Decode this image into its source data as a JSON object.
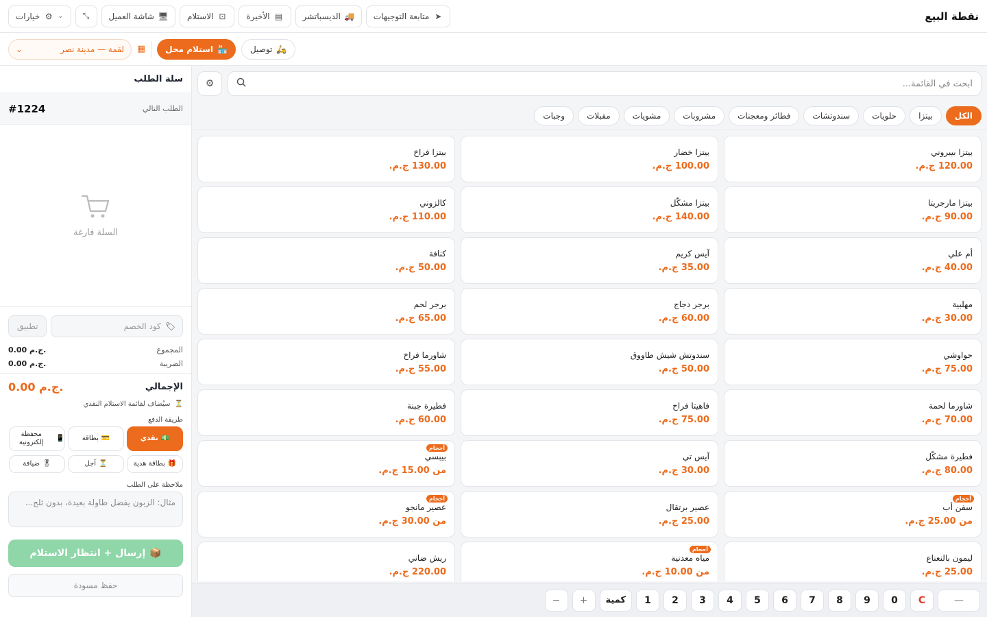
{
  "header": {
    "title": "نقطة البيع",
    "buttons": [
      {
        "label": "متابعة التوجيهات",
        "icon": "send-icon"
      },
      {
        "label": "الديسباتشر",
        "icon": "truck-icon"
      },
      {
        "label": "الأخيرة",
        "icon": "receipt-icon"
      },
      {
        "label": "الاستلام",
        "icon": "inbox-icon"
      },
      {
        "label": "شاشة العميل",
        "icon": "monitor-icon"
      },
      {
        "label": "",
        "icon": "fullscreen-exit-icon"
      },
      {
        "label": "خيارات",
        "icon": "gear-icon"
      }
    ]
  },
  "order_type": {
    "delivery_label": "توصيل",
    "pickup_label": "استلام محل",
    "branch": "لقمة — مدينة نصر"
  },
  "search": {
    "placeholder": "ابحث في القائمة..."
  },
  "categories": [
    "الكل",
    "بيتزا",
    "حلويات",
    "سندوتشات",
    "فطائر ومعجنات",
    "مشروبات",
    "مشويات",
    "مقبلات",
    "وجبات"
  ],
  "products": [
    {
      "name": "بيتزا بيبروني",
      "price": "120.00 ج.م."
    },
    {
      "name": "بيتزا خضار",
      "price": "100.00 ج.م."
    },
    {
      "name": "بيتزا فراخ",
      "price": "130.00 ج.م."
    },
    {
      "name": "بيتزا مارجريتا",
      "price": "90.00 ج.م."
    },
    {
      "name": "بيتزا مشكّل",
      "price": "140.00 ج.م."
    },
    {
      "name": "كالزوني",
      "price": "110.00 ج.م."
    },
    {
      "name": "أم علي",
      "price": "40.00 ج.م."
    },
    {
      "name": "آيس كريم",
      "price": "35.00 ج.م."
    },
    {
      "name": "كنافة",
      "price": "50.00 ج.م."
    },
    {
      "name": "مهلبية",
      "price": "30.00 ج.م."
    },
    {
      "name": "برجر دجاج",
      "price": "60.00 ج.م."
    },
    {
      "name": "برجر لحم",
      "price": "65.00 ج.م."
    },
    {
      "name": "حواوشي",
      "price": "75.00 ج.م."
    },
    {
      "name": "سندوتش شيش طاووق",
      "price": "50.00 ج.م."
    },
    {
      "name": "شاورما فراخ",
      "price": "55.00 ج.م."
    },
    {
      "name": "شاورما لحمة",
      "price": "70.00 ج.م."
    },
    {
      "name": "فاهيتا فراخ",
      "price": "75.00 ج.م."
    },
    {
      "name": "فطيرة جبنة",
      "price": "60.00 ج.م."
    },
    {
      "name": "فطيرة مشكّل",
      "price": "80.00 ج.م."
    },
    {
      "name": "آيس تي",
      "price": "30.00 ج.م."
    },
    {
      "name": "بيبسي",
      "price": "من 15.00 ج.م.",
      "badge": "أحجام"
    },
    {
      "name": "سفن أب",
      "price": "من 25.00 ج.م.",
      "badge": "أحجام"
    },
    {
      "name": "عصير برتقال",
      "price": "25.00 ج.م."
    },
    {
      "name": "عصير مانجو",
      "price": "من 30.00 ج.م.",
      "badge": "أحجام"
    },
    {
      "name": "ليمون بالنعناع",
      "price": "25.00 ج.م."
    },
    {
      "name": "مياه معدنية",
      "price": "من 10.00 ج.م.",
      "badge": "أحجام"
    },
    {
      "name": "ريش ضاني",
      "price": "220.00 ج.م."
    }
  ],
  "keypad": {
    "keys": [
      "—",
      "C",
      "0",
      "9",
      "8",
      "7",
      "6",
      "5",
      "4",
      "3",
      "2",
      "1"
    ],
    "qty_label": "كمية",
    "plus": "+",
    "minus": "−"
  },
  "cart": {
    "title": "سلة الطلب",
    "next_order_label": "الطلب التالي",
    "next_order_number": "#1224",
    "empty_text": "السلة فارغة",
    "promo_placeholder": "كود الخصم",
    "apply_label": "تطبيق",
    "subtotal_label": "المجموع",
    "subtotal_value": "0.00 ج.م.",
    "tax_label": "الضريبة",
    "tax_value": "0.00 ج.م.",
    "total_label": "الإجمالي",
    "total_value": "0.00 ج.م.",
    "cash_note": "سيُضاف لقائمة الاستلام النقدي",
    "payment_label": "طريقة الدفع",
    "payments": [
      {
        "label": "نقدي",
        "icon": "💵"
      },
      {
        "label": "بطاقة",
        "icon": "💳"
      },
      {
        "label": "محفظة إلكترونية",
        "icon": "📱"
      },
      {
        "label": "بطاقة هدية",
        "icon": "🎁"
      },
      {
        "label": "آجل",
        "icon": "⏳"
      },
      {
        "label": "ضيافة",
        "icon": "🎖"
      }
    ],
    "note_label": "ملاحظة على الطلب",
    "note_placeholder": "مثال: الزبون يفضل طاولة بعيدة، بدون ثلج...",
    "send_label": "إرسال + انتظار الاستلام",
    "draft_label": "حفظ مسودة"
  },
  "colors": {
    "accent": "#ec6b1c",
    "send_disabled": "#8fd6a8"
  }
}
